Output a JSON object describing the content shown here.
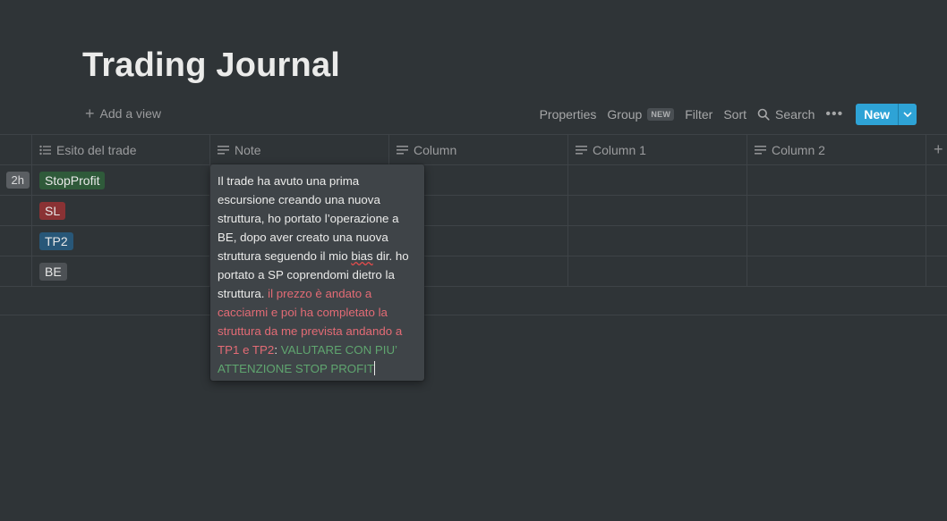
{
  "page": {
    "title": "Trading Journal",
    "add_view_label": "Add a view"
  },
  "toolbar": {
    "properties": "Properties",
    "group": "Group",
    "group_badge": "NEW",
    "filter": "Filter",
    "sort": "Sort",
    "search": "Search",
    "new_label": "New"
  },
  "table": {
    "columns": [
      {
        "label": "Esito del trade",
        "icon": "list-icon"
      },
      {
        "label": "Note",
        "icon": "text-icon"
      },
      {
        "label": "Column",
        "icon": "text-icon"
      },
      {
        "label": "Column 1",
        "icon": "text-icon"
      },
      {
        "label": "Column 2",
        "icon": "text-icon"
      }
    ],
    "rows": [
      {
        "partial_tag": "2h",
        "esito": "StopProfit",
        "esito_color": "#2f5a3a"
      },
      {
        "partial_tag": "",
        "esito": "SL",
        "esito_color": "#8a3234"
      },
      {
        "partial_tag": "",
        "esito": "TP2",
        "esito_color": "#285778"
      },
      {
        "partial_tag": "",
        "esito": "BE",
        "esito_color": "#4d5155"
      }
    ]
  },
  "note_popup": {
    "text_white_1": "Il trade ha avuto una prima escursione creando una nuova struttura, ho portato l’operazione a BE, dopo aver creato una nuova struttura seguendo il mio ",
    "text_misspelled": "bias",
    "text_white_2": " dir. ho portato a SP coprendomi dietro la struttura. ",
    "text_red": "il prezzo è andato a cacciarmi e poi ha completato la struttura da me prevista andando a TP1 e TP2",
    "text_colon": ": ",
    "text_green": "VALUTARE CON PIU’ ATTENZIONE STOP PROFIT"
  },
  "colors": {
    "background": "#2f3437",
    "accent": "#2ea3d6",
    "red_text": "#e36b75",
    "green_text": "#5fa56f"
  }
}
